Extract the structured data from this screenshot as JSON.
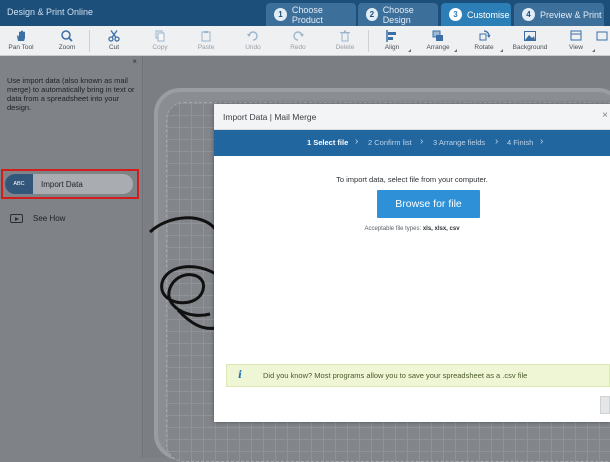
{
  "app": {
    "title": "Design & Print Online"
  },
  "steps": [
    {
      "num": "1",
      "label": "Choose Product",
      "active": false
    },
    {
      "num": "2",
      "label": "Choose Design",
      "active": false
    },
    {
      "num": "3",
      "label": "Customise",
      "active": true
    },
    {
      "num": "4",
      "label": "Preview & Print",
      "active": false
    }
  ],
  "toolbar": {
    "pan": "Pan Tool",
    "zoom": "Zoom",
    "cut": "Cut",
    "copy": "Copy",
    "paste": "Paste",
    "undo": "Undo",
    "redo": "Redo",
    "delete": "Delete",
    "align": "Align",
    "arrange": "Arrange",
    "rotate": "Rotate",
    "background": "Background",
    "view": "View"
  },
  "left_panel": {
    "close": "×",
    "description": "Use import data (also known as mail merge) to automatically bring in text or data from a spreadsheet into your design.",
    "import_badge": "ABC",
    "import_label": "Import Data",
    "see_how": "See How"
  },
  "modal": {
    "title": "Import Data | Mail Merge",
    "close": "×",
    "wizard": [
      {
        "label": "1 Select file",
        "active": true
      },
      {
        "label": "2 Confirm list",
        "active": false
      },
      {
        "label": "3 Arrange fields",
        "active": false
      },
      {
        "label": "4 Finish",
        "active": false
      }
    ],
    "instruction": "To import data, select file from your computer.",
    "browse_button": "Browse for file",
    "types_prefix": "Acceptable file types:",
    "types_list": "xls, xlsx, csv",
    "tip_icon": "i",
    "tip_text": "Did you know? Most programs allow you to save your spreadsheet as a .csv file"
  },
  "colors": {
    "header": "#1d4f7b",
    "active_step": "#2c7fb6",
    "wizard": "#2266a0",
    "button": "#2e90d6",
    "highlight": "#d21d1d",
    "tip_bg": "#eef6d6"
  }
}
